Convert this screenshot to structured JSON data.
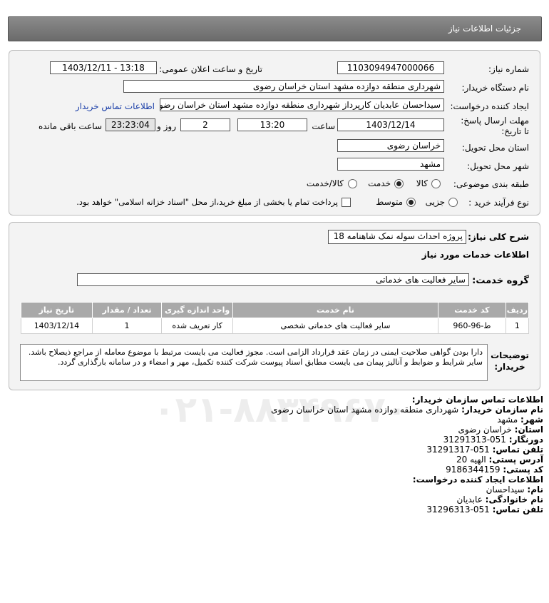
{
  "header": {
    "title": "جزئیات اطلاعات نیاز"
  },
  "fields": {
    "need_number_label": "شماره نیاز:",
    "need_number": "1103094947000066",
    "announce_label": "تاریخ و ساعت اعلان عمومی:",
    "announce_value": "1403/12/11 - 13:18",
    "buyer_org_label": "نام دستگاه خریدار:",
    "buyer_org": "شهرداری منطقه دوازده مشهد استان خراسان رضوی",
    "requester_label": "ایجاد کننده درخواست:",
    "requester": "سیداحسان عابدیان کارپرداز شهرداری منطقه دوازده مشهد استان خراسان رضوی",
    "contact_link": "اطلاعات تماس خریدار",
    "deadline_label": "مهلت ارسال پاسخ: تا تاریخ:",
    "deadline_date": "1403/12/14",
    "time_label": "ساعت",
    "deadline_time": "13:20",
    "days_value": "2",
    "days_label": "روز و",
    "remaining_time": "23:23:04",
    "remaining_label": "ساعت باقی مانده",
    "province_label": "استان محل تحویل:",
    "province": "خراسان رضوی",
    "city_label": "شهر محل تحویل:",
    "city": "مشهد",
    "category_label": "طبقه بندی موضوعی:",
    "category_options": [
      "کالا",
      "خدمت",
      "کالا/خدمت"
    ],
    "process_label": "نوع فرآیند خرید :",
    "process_options": [
      "جزیی",
      "متوسط"
    ],
    "payment_note": "پرداخت تمام یا بخشی از مبلغ خرید،از محل \"اسناد خزانه اسلامی\" خواهد بود."
  },
  "summary": {
    "label": "شرح کلی نیاز:",
    "value": "پروژه احداث سوله نمک شاهنامه 18",
    "services_title": "اطلاعات خدمات مورد نیاز",
    "group_label": "گروه خدمت:",
    "group_value": "سایر فعالیت های خدماتی"
  },
  "table": {
    "headers": [
      "ردیف",
      "کد خدمت",
      "نام خدمت",
      "واحد اندازه گیری",
      "تعداد / مقدار",
      "تاریخ نیاز"
    ],
    "rows": [
      [
        "1",
        "ط-96-960",
        "سایر فعالیت های خدماتی شخصی",
        "کار تعریف شده",
        "1",
        "1403/12/14"
      ]
    ]
  },
  "description": {
    "label": "توضیحات خریدار:",
    "text": "دارا بودن گواهی صلاحیت ایمنی در زمان عقد قرارداد الزامی است. مجوز فعالیت می بایست مرتبط با موضوع معامله از مراجع ذیصلاح باشد. سایر شرایط و ضوابط و آنالیز پیمان می بایست مطابق اسناد پیوست شرکت کننده تکمیل، مهر و امضاء و در سامانه بارگذاری گردد."
  },
  "contact": {
    "title": "اطلاعات تماس سازمان خریدار:",
    "org_label": "نام سازمان خریدار:",
    "org": "شهرداری منطقه دوازده مشهد استان خراسان رضوی",
    "city_label": "شهر:",
    "city": "مشهد",
    "province_label": "استان:",
    "province": "خراسان رضوی",
    "fax_label": "دورنگار:",
    "fax": "051-31291313",
    "phone_label": "تلفن تماس:",
    "phone": "051-31291317",
    "address_label": "آدرس پستی:",
    "address": "الهیه 20",
    "postal_label": "کد پستی:",
    "postal": "9186344159",
    "creator_title": "اطلاعات ایجاد کننده درخواست:",
    "name_label": "نام:",
    "name": "سیداحسان",
    "family_label": "نام خانوادگی:",
    "family": "عابدیان",
    "creator_phone_label": "تلفن تماس:",
    "creator_phone": "051-31296313"
  }
}
